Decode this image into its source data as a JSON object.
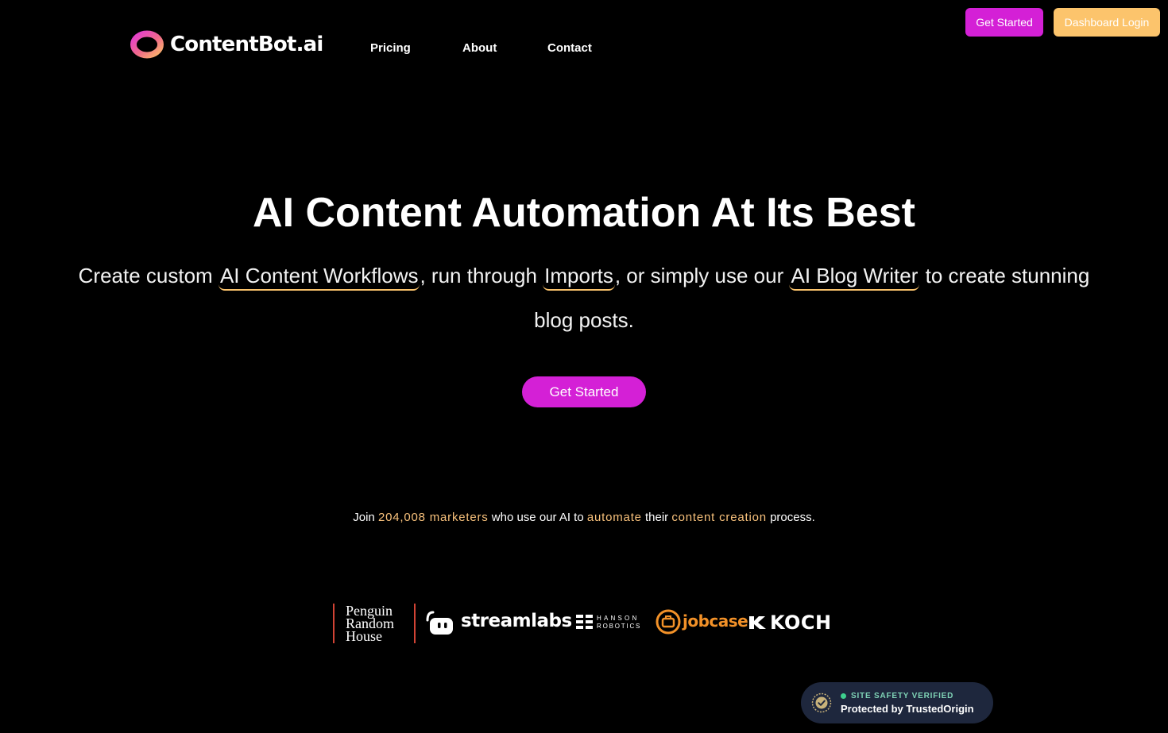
{
  "header": {
    "brand": "ContentBot.ai",
    "nav": [
      {
        "label": "Pricing"
      },
      {
        "label": "About"
      },
      {
        "label": "Contact"
      }
    ],
    "get_started_label": "Get Started",
    "dashboard_login_label": "Dashboard Login"
  },
  "hero": {
    "title": "AI Content Automation At Its Best",
    "sub_1": "Create custom",
    "link_workflows": "AI Content Workflows",
    "sub_2": ", run through",
    "link_imports": "Imports",
    "sub_3": ", or simply use our",
    "link_blog_writer": "AI Blog Writer",
    "sub_4": "to create stunning blog posts.",
    "cta_label": "Get Started"
  },
  "social_proof": {
    "t1": "Join",
    "count": "204,008 marketers",
    "t2": "who use our AI to",
    "automate": "automate",
    "t3": "their",
    "content_creation": "content creation",
    "t4": "process."
  },
  "client_logos": {
    "penguin": [
      "Penguin",
      "Random",
      "House"
    ],
    "streamlabs": "streamlabs",
    "hanson_1": "HANSON",
    "hanson_2": "ROBOTICS",
    "jobcase": "jobcase",
    "koch": "KOCH"
  },
  "trust_badge": {
    "verified": "SITE SAFETY VERIFIED",
    "protected": "Protected by TrustedOrigin"
  },
  "colors": {
    "background": "#000000",
    "primary_magenta": "#d420d6",
    "accent_gold": "#fcc46c",
    "highlight_text": "#f9c27c",
    "badge_bg": "#1e273d"
  },
  "icons": {
    "logo_mark": "ring-gradient-icon",
    "badge": "shield-check-icon"
  }
}
